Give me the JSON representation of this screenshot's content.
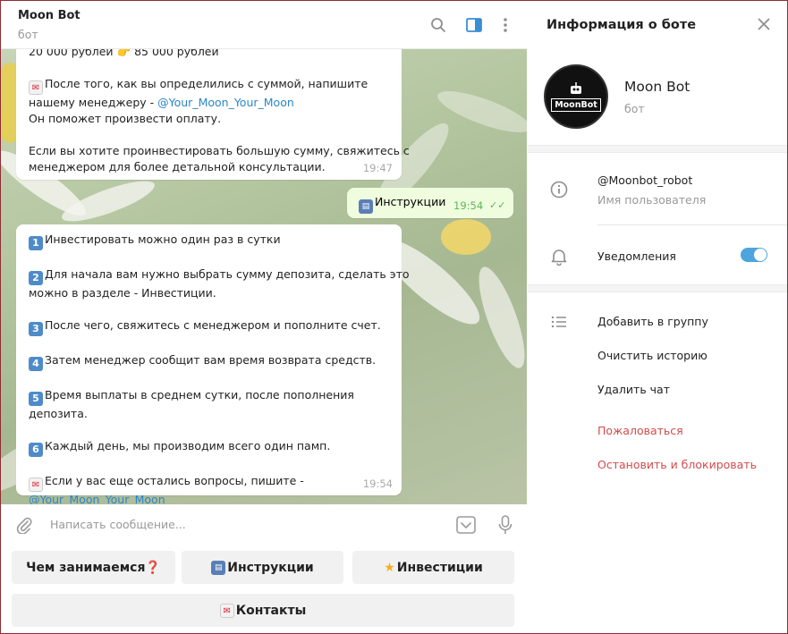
{
  "chat": {
    "title": "Moon Bot",
    "status": "бот",
    "messages": [
      {
        "lines": [
          "20 000 рублей 👉 85 000 рублей",
          "",
          "После того, как вы определились с суммой, напишите",
          "нашему менеджеру - ",
          "Он поможет произвести оплату.",
          "",
          "Если вы хотите проинвестировать большую сумму, свяжитесь с",
          "менеджером для более детальной консультации."
        ],
        "link": "@Your_Moon_Your_Moon",
        "time": "19:47"
      },
      {
        "text": "Инструкции",
        "time": "19:54"
      },
      {
        "lines": [
          "Инвестировать можно один раз в сутки",
          "Для начала вам нужно выбрать сумму депозита, сделать это",
          "можно в разделе - Инвестиции.",
          "После чего, свяжитесь с менеджером и пополните счет.",
          "Затем менеджер сообщит вам время возврата средств.",
          "Время выплаты в среднем сутки, после пополнения",
          "депозита.",
          "Каждый день, мы производим всего один памп.",
          "Если у вас еще остались вопросы, пишите -"
        ],
        "link": "@Your_Moon_Your_Moon",
        "time": "19:54",
        "keycaps": [
          "1",
          "2",
          "3",
          "4",
          "5",
          "6"
        ]
      }
    ],
    "composer_placeholder": "Написать сообщение...",
    "keyboard": {
      "row1": [
        "Чем занимаемся❓",
        "Инструкции",
        "Инвестиции"
      ],
      "row2": [
        "Контакты"
      ]
    }
  },
  "info": {
    "title": "Информация о боте",
    "avatar_text": "MoonBot",
    "name": "Moon Bot",
    "subtitle": "бот",
    "username": "@Moonbot_robot",
    "username_label": "Имя пользователя",
    "notifications_label": "Уведомления",
    "notifications_on": true,
    "actions": {
      "add_to_group": "Добавить в группу",
      "clear_history": "Очистить историю",
      "delete_chat": "Удалить чат",
      "report": "Пожаловаться",
      "stop_block": "Остановить и блокировать"
    }
  },
  "colors": {
    "accent": "#4ea4dc",
    "danger": "#d14c4c",
    "outgoing_bubble": "#effdde",
    "link": "#2b87c7",
    "window_border": "#8e2d35"
  },
  "icons": [
    "search-icon",
    "sidebar-toggle-icon",
    "more-icon",
    "close-icon",
    "info-icon",
    "bell-icon",
    "list-icon",
    "attach-icon",
    "bot-keyboard-icon",
    "microphone-icon"
  ]
}
